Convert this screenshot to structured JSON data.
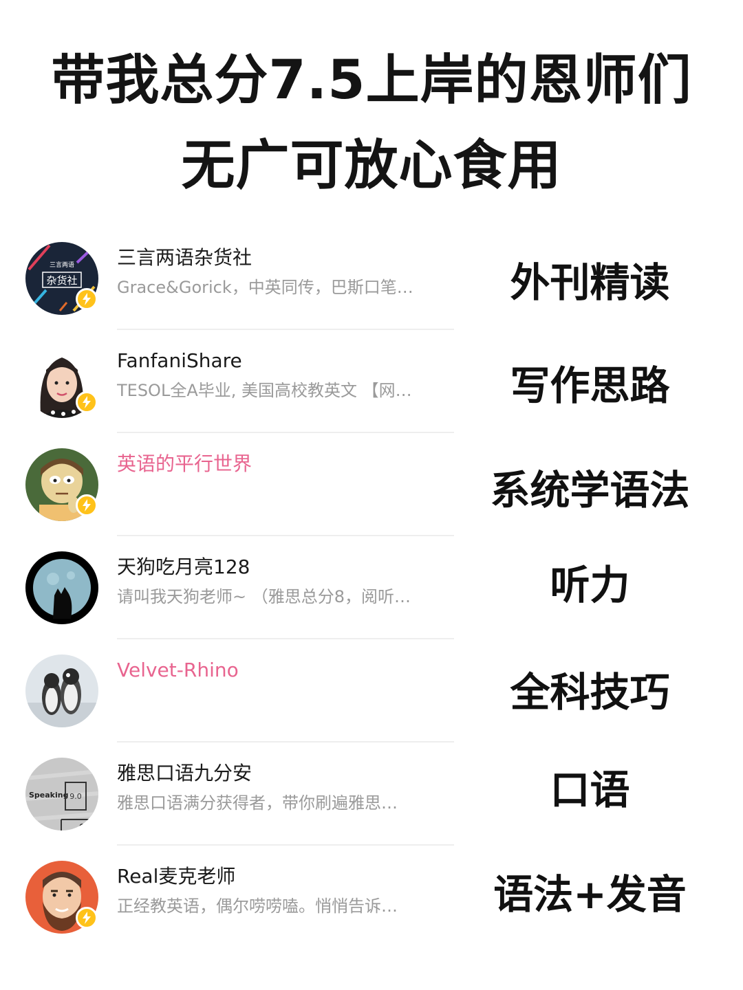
{
  "header": {
    "title_line1": "带我总分7.5上岸的恩师们",
    "title_line2": "无广可放心食用"
  },
  "accounts": [
    {
      "name": "三言两语杂货社",
      "description": "Grace&Gorick，中英同传，巴斯口笔…",
      "tag": "外刊精读",
      "avatar_text_top": "三言两语",
      "avatar_text_main": "杂货社",
      "verified": true
    },
    {
      "name": "FanfaniShare",
      "description": "TESOL全A毕业, 美国高校教英文 【网…",
      "tag": "写作思路",
      "verified": true
    },
    {
      "name": "英语的平行世界",
      "description": "",
      "tag": "系统学语法",
      "name_color": "#e8648f",
      "verified": true
    },
    {
      "name": "天狗吃月亮128",
      "description": "请叫我天狗老师~ （雅思总分8，阅听…",
      "tag": "听力",
      "verified": false
    },
    {
      "name": "Velvet-Rhino",
      "description": "",
      "tag": "全科技巧",
      "name_color": "#e8648f",
      "verified": false
    },
    {
      "name": "雅思口语九分安",
      "description": "雅思口语满分获得者，带你刷遍雅思…",
      "tag": "口语",
      "avatar_text_main": "Speaking",
      "avatar_text_score": "9.0",
      "avatar_text_corner": "Co",
      "verified": false
    },
    {
      "name": "Real麦克老师",
      "description": "正经教英语，偶尔唠唠嗑。悄悄告诉…",
      "tag": "语法+发音",
      "verified": true
    }
  ],
  "colors": {
    "badge": "#ffc21a",
    "pink_name": "#e8648f",
    "description": "#9a9a9a"
  },
  "icons": [
    "lightning-icon"
  ]
}
